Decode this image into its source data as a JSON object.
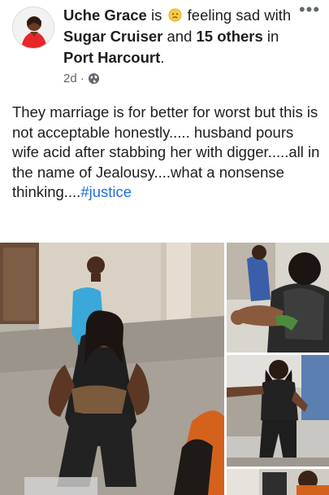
{
  "post": {
    "author": "Uche Grace",
    "is_word": "is",
    "feeling": "feeling sad",
    "feeling_emoji": "sad-face-icon",
    "with_word": "with",
    "tagged_friend": "Sugar Cruiser",
    "and_word": "and",
    "others": "15 others",
    "in_word": "in",
    "location": "Port Harcourt",
    "time": "2d",
    "privacy_icon": "globe-icon",
    "more_label": "•••",
    "body_text": "They marriage is for better for worst but this is not acceptable honestly..... husband pours wife acid after stabbing her with digger.....all in the name of Jealousy....what a nonsense thinking....",
    "hashtag": "#justice"
  },
  "photos": {
    "count_shown": 4
  },
  "colors": {
    "link_blue": "#216fdb",
    "meta_gray": "#606770",
    "text": "#1c1e21",
    "avatar_dress": "#e8262a"
  }
}
